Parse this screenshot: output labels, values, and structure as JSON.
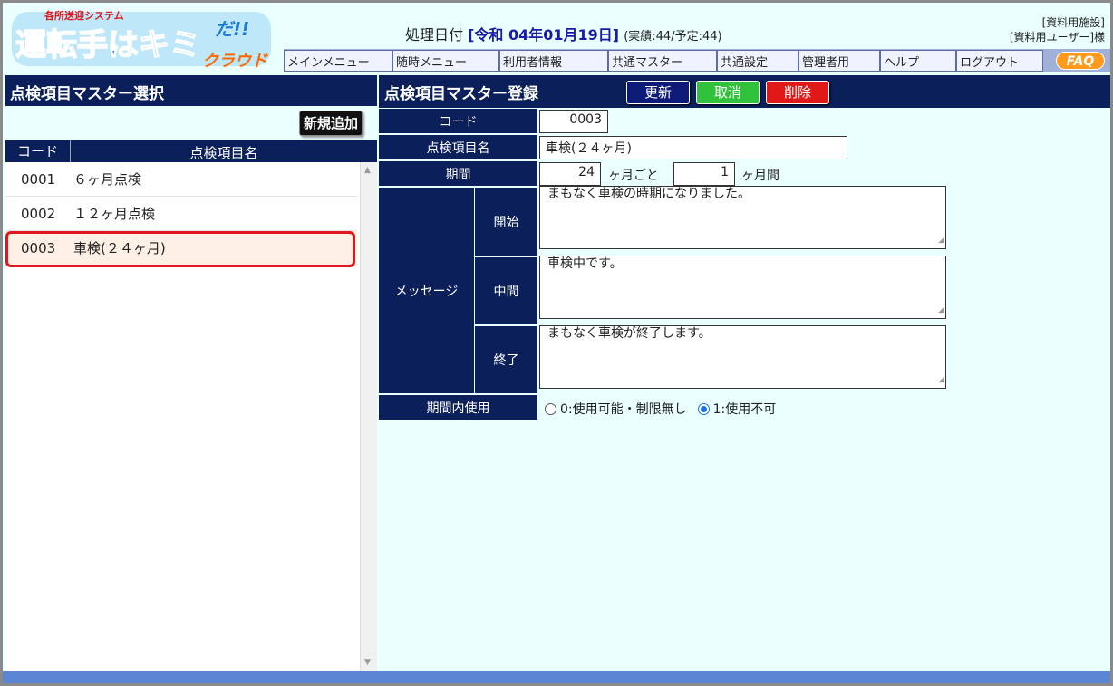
{
  "header": {
    "logo_small": "各所送迎システム",
    "logo_main": "運転手はキミ",
    "logo_da": "だ!!",
    "logo_cloud": "クラウド",
    "date_label": "処理日付",
    "date_value": "[令和 04年01月19日]",
    "date_counts": "(実績:44/予定:44)",
    "facility": "[資料用施設]",
    "user": "[資料用ユーザー]様"
  },
  "menu": [
    "メインメニュー",
    "随時メニュー",
    "利用者情報",
    "共通マスター",
    "共通設定",
    "管理者用",
    "ヘルプ",
    "ログアウト"
  ],
  "faq_label": "FAQ",
  "left": {
    "title": "点検項目マスター選択",
    "new_button": "新規追加",
    "col_code": "コード",
    "col_name": "点検項目名",
    "rows": [
      {
        "code": "0001",
        "name": "６ヶ月点検"
      },
      {
        "code": "0002",
        "name": "１２ヶ月点検"
      },
      {
        "code": "0003",
        "name": "車検(２４ヶ月)"
      }
    ]
  },
  "right": {
    "title": "点検項目マスター登録",
    "btn_update": "更新",
    "btn_cancel": "取消",
    "btn_delete": "削除",
    "label_code": "コード",
    "label_name": "点検項目名",
    "label_period": "期間",
    "label_message": "メッセージ",
    "label_start": "開始",
    "label_middle": "中間",
    "label_end": "終了",
    "label_in_period": "期間内使用",
    "code_value": "0003",
    "name_value": "車検(２４ヶ月)",
    "period_value": "24",
    "period_unit": "ヶ月ごと",
    "span_value": "1",
    "span_unit": "ヶ月間",
    "msg_start": "まもなく車検の時期になりました。",
    "msg_middle": "車検中です。",
    "msg_end": "まもなく車検が終了します。",
    "radio_0": "0:使用可能・制限無し",
    "radio_1": "1:使用不可",
    "radio_selected": "1"
  },
  "colors": {
    "navy": "#0b1f5b",
    "background": "#eaffff",
    "update": "#0e1a78",
    "cancel": "#2fc23a",
    "delete": "#e01818",
    "selection_outline": "#e0181d"
  }
}
